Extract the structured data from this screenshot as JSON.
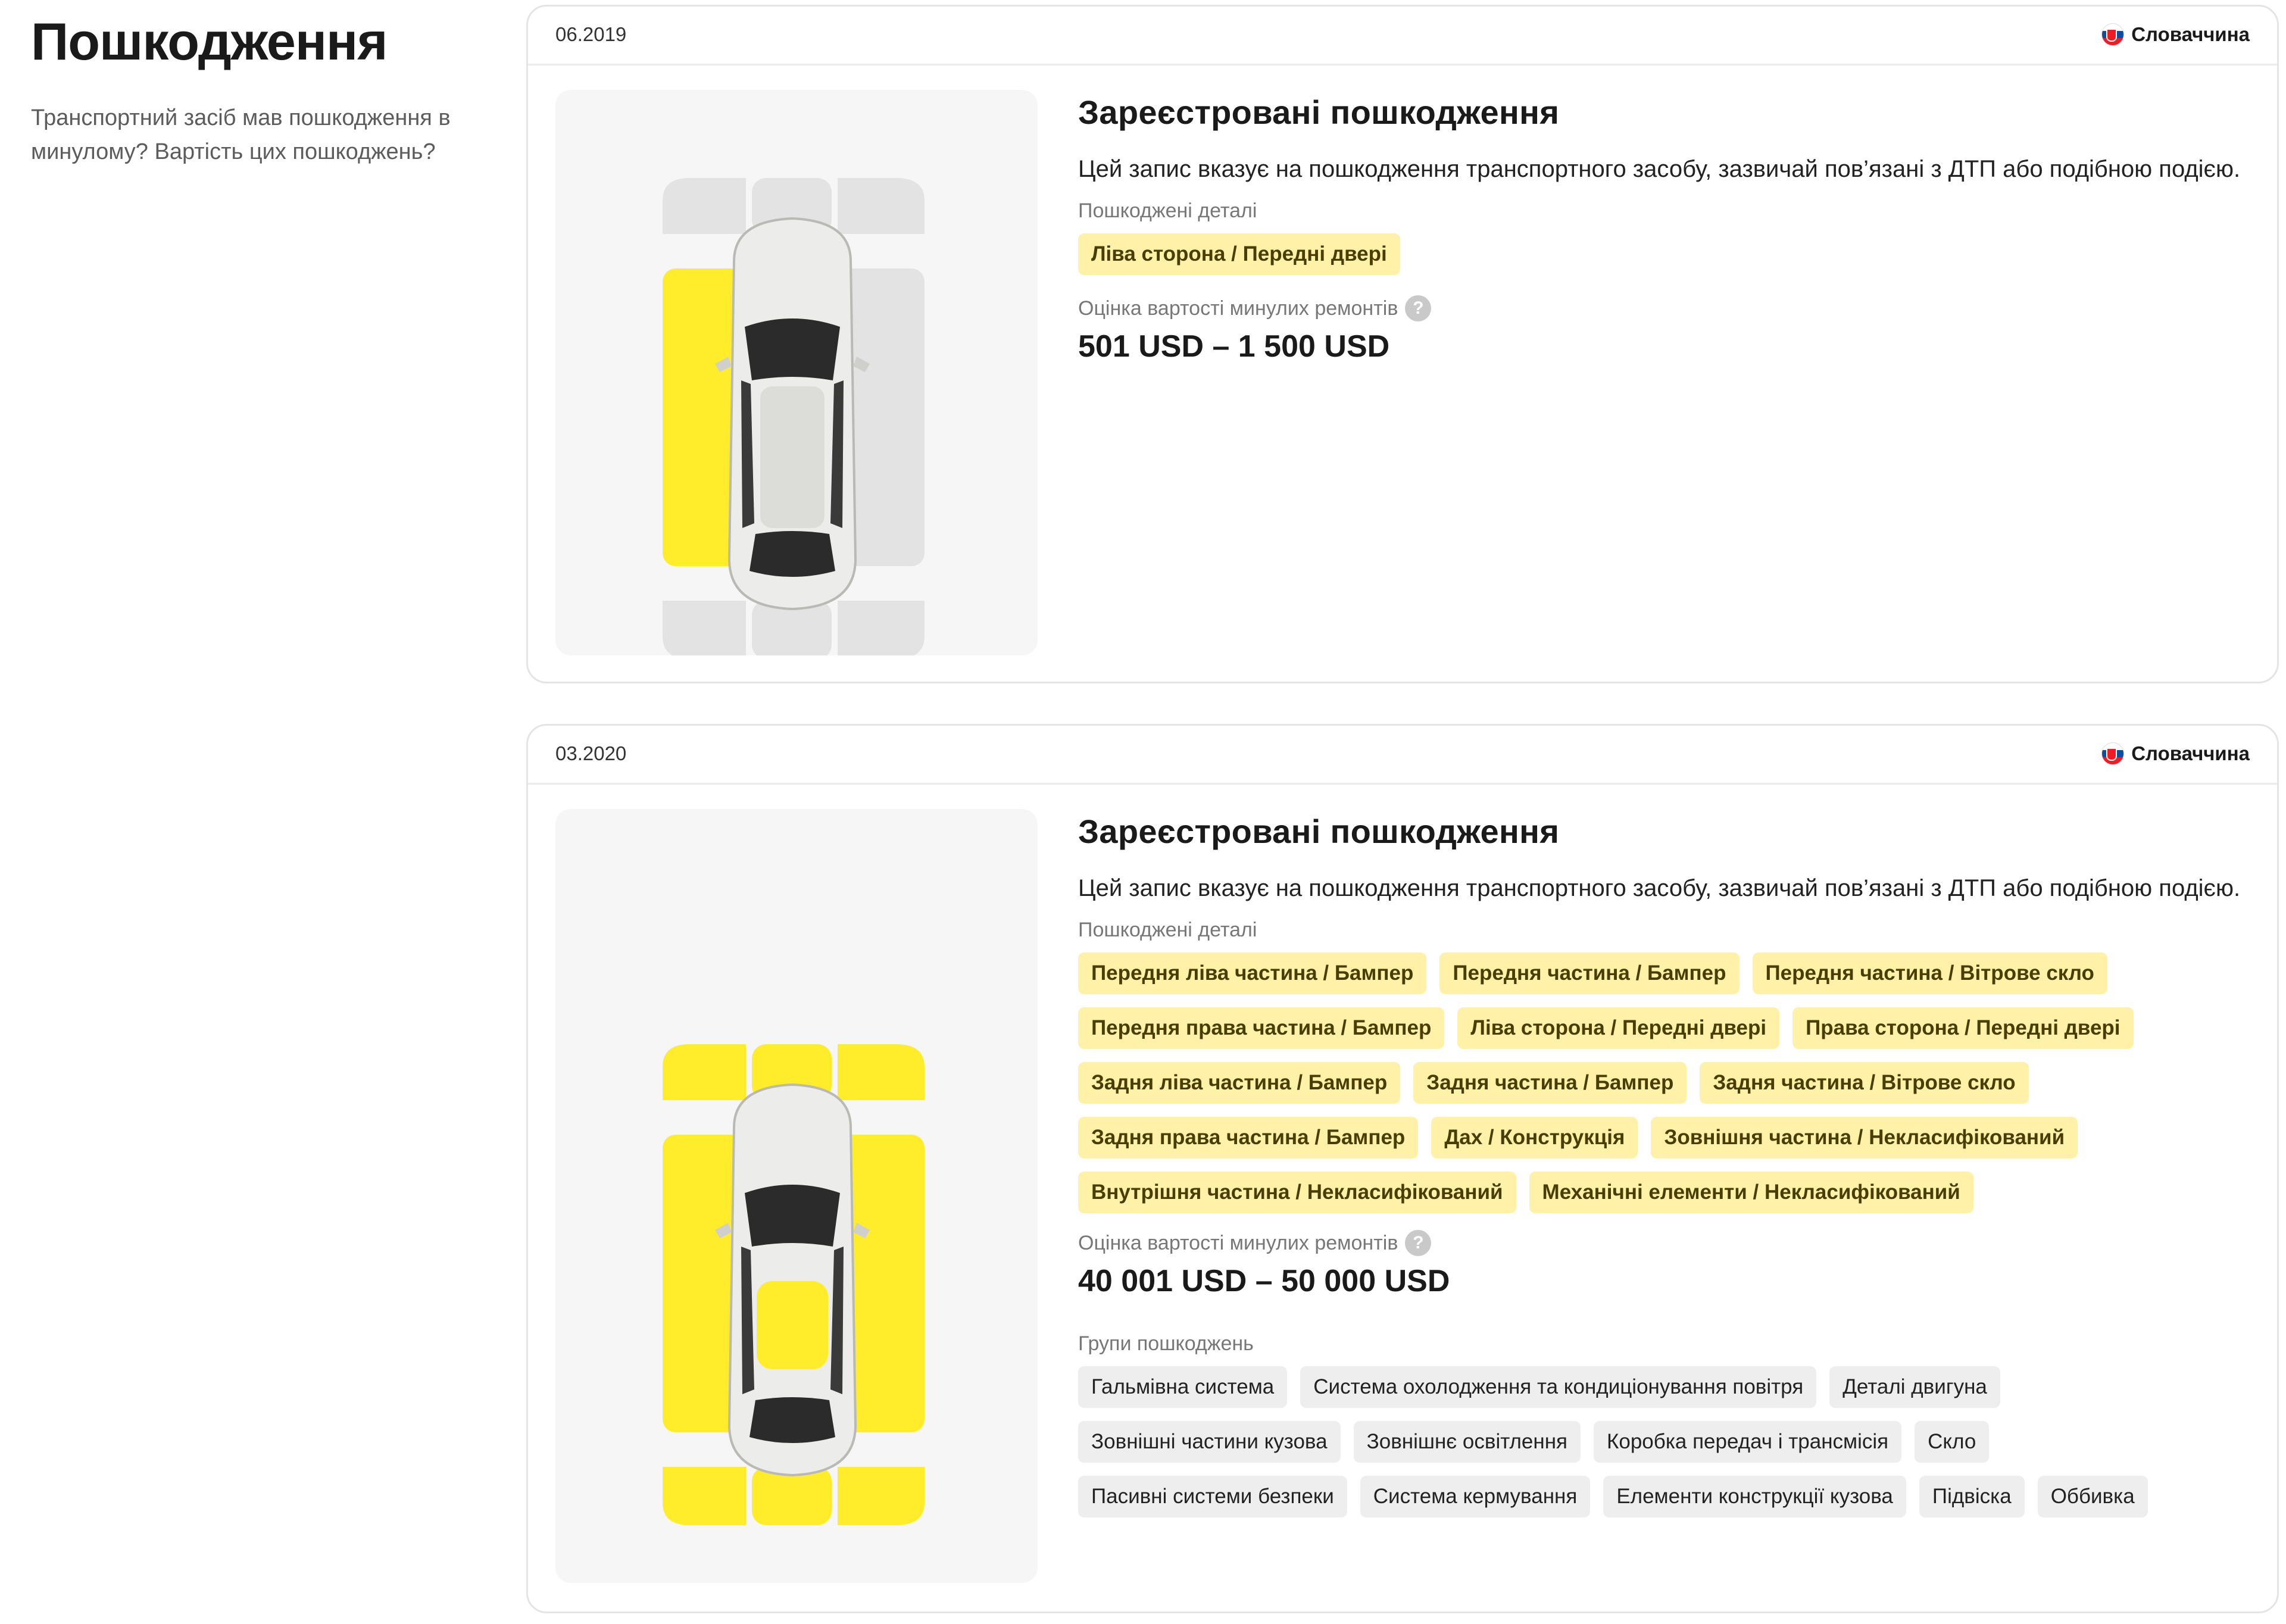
{
  "intro": {
    "title": "Пошкодження",
    "subtitle": "Транспортний засіб мав пошкодження в минулому? Вартість цих пошкоджень?"
  },
  "records": [
    {
      "date": "06.2019",
      "country": "Словаччина",
      "title": "Зареєстровані пошкодження",
      "description": "Цей запис вказує на пошкодження транспортного засобу, зазвичай пов’язані з ДТП або подібною подією.",
      "damaged_parts_label": "Пошкоджені деталі",
      "damaged_parts": [
        "Ліва сторона / Передні двері"
      ],
      "cost_label": "Оцінка вартості минулих ремонтів",
      "cost": "501 USD – 1 500 USD"
    },
    {
      "date": "03.2020",
      "country": "Словаччина",
      "title": "Зареєстровані пошкодження",
      "description": "Цей запис вказує на пошкодження транспортного засобу, зазвичай пов’язані з ДТП або подібною подією.",
      "damaged_parts_label": "Пошкоджені деталі",
      "damaged_parts": [
        "Передня ліва частина / Бампер",
        "Передня частина / Бампер",
        "Передня частина / Вітрове скло",
        "Передня права частина / Бампер",
        "Ліва сторона / Передні двері",
        "Права сторона / Передні двері",
        "Задня ліва частина / Бампер",
        "Задня частина / Бампер",
        "Задня частина / Вітрове скло",
        "Задня права частина / Бампер",
        "Дах / Конструкція",
        "Зовнішня частина / Некласифікований",
        "Внутрішня частина / Некласифікований",
        "Механічні елементи / Некласифікований"
      ],
      "cost_label": "Оцінка вартості минулих ремонтів",
      "cost": "40 001 USD – 50 000 USD",
      "groups_label": "Групи пошкоджень",
      "groups": [
        "Гальмівна система",
        "Система охолодження та кондиціонування повітря",
        "Деталі двигуна",
        "Зовнішні частини кузова",
        "Зовнішнє освітлення",
        "Коробка передач і трансмісія",
        "Скло",
        "Пасивні системи безпеки",
        "Система кермування",
        "Елементи конструкції кузова",
        "Підвіска",
        "Оббивка"
      ]
    }
  ],
  "help_glyph": "?",
  "colors": {
    "highlight": "#ffed2b",
    "zone_idle": "#e3e3e3",
    "chip_yellow": "#fff2a8",
    "chip_gray": "#eeeeee"
  }
}
